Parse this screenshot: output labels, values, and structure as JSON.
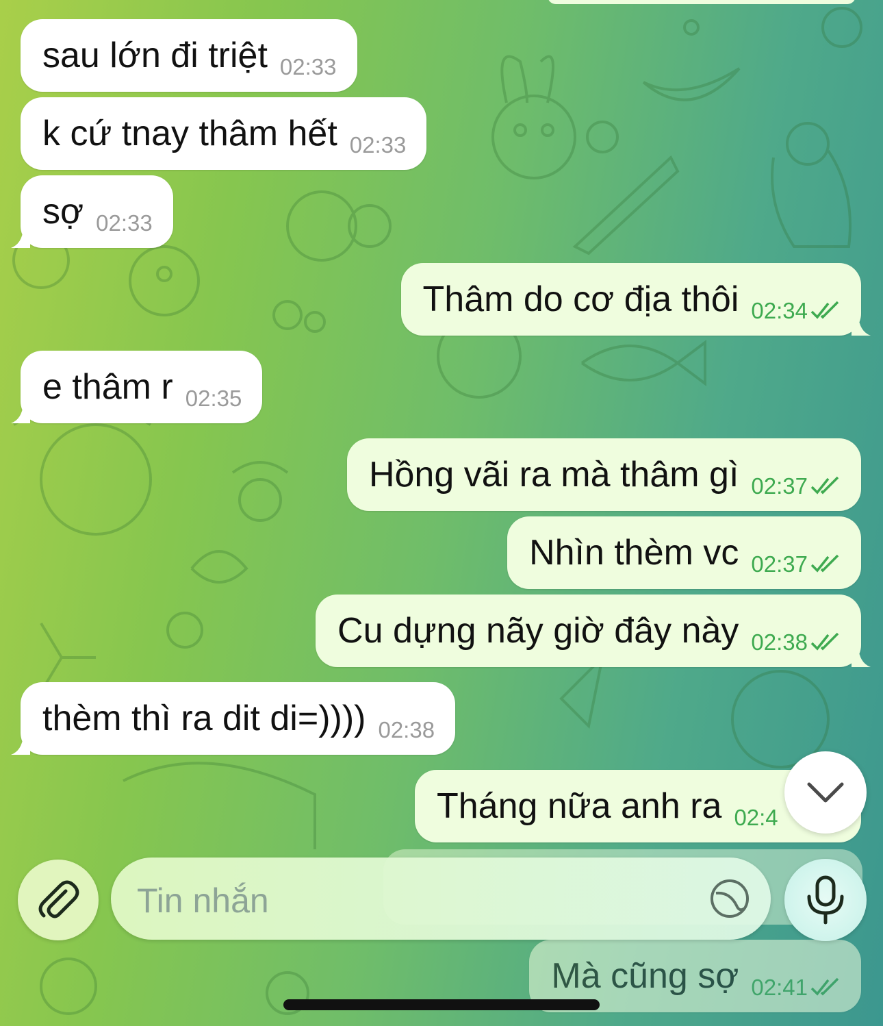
{
  "composer": {
    "placeholder": "Tin nhắn"
  },
  "messages": [
    {
      "dir": "in",
      "text": "sau lớn đi triệt",
      "time": "02:33"
    },
    {
      "dir": "in",
      "text": "k cứ tnay thâm hết",
      "time": "02:33"
    },
    {
      "dir": "in",
      "text": "sợ",
      "time": "02:33"
    },
    {
      "dir": "out",
      "text": "Thâm do cơ địa thôi",
      "time": "02:34"
    },
    {
      "dir": "in",
      "text": "e thâm r",
      "time": "02:35"
    },
    {
      "dir": "out",
      "text": "Hồng vãi ra mà thâm gì",
      "time": "02:37"
    },
    {
      "dir": "out",
      "text": "Nhìn thèm vc",
      "time": "02:37"
    },
    {
      "dir": "out",
      "text": "Cu dựng nãy giờ đây này",
      "time": "02:38"
    },
    {
      "dir": "in",
      "text": "thèm thì ra dit di=))))",
      "time": "02:38"
    },
    {
      "dir": "out",
      "text": "Tháng nữa anh ra",
      "time": "02:4"
    },
    {
      "dir": "out",
      "text": "Mà cũng sợ",
      "time": "02:41"
    }
  ],
  "icons": {
    "attach": "paperclip-icon",
    "sticker": "sticker-icon",
    "mic": "microphone-icon",
    "scroll": "chevron-down-icon",
    "read": "double-check-icon"
  },
  "colors": {
    "incoming_bubble": "#ffffff",
    "outgoing_bubble": "#effdde",
    "outgoing_time": "#3eaa50"
  }
}
